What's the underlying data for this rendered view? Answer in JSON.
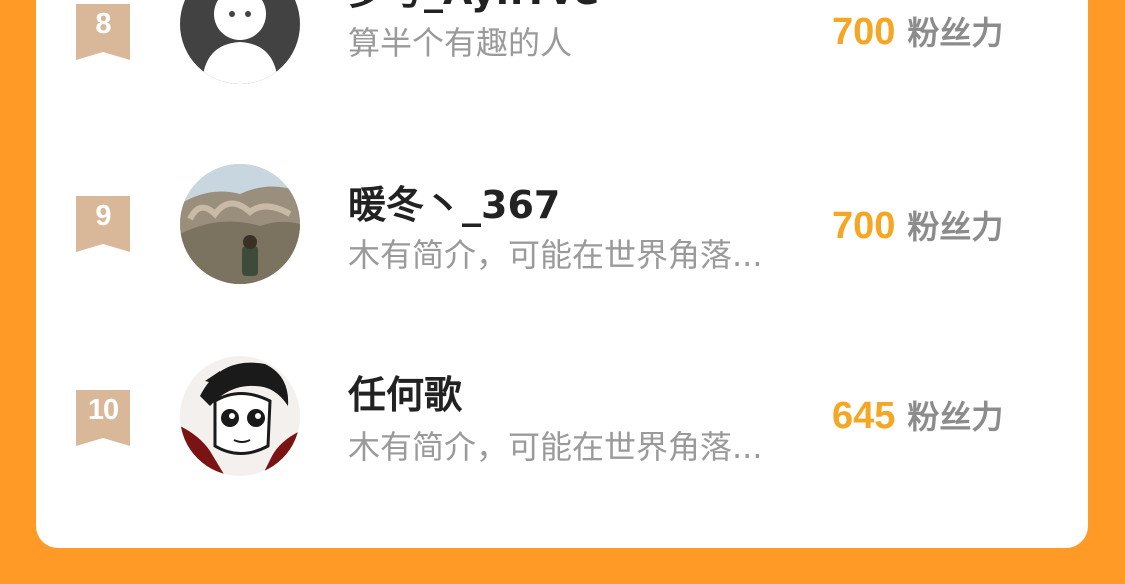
{
  "leaderboard": {
    "rows": [
      {
        "rank": "8",
        "name": "梦号_AynTve",
        "bio": "算半个有趣的人",
        "score": "700",
        "unit": "粉丝力",
        "avatar": "default-ghost-avatar"
      },
      {
        "rank": "9",
        "name": "暖冬丶_367",
        "bio": "木有简介，可能在世界角落...",
        "score": "700",
        "unit": "粉丝力",
        "avatar": "landscape-photo-avatar"
      },
      {
        "rank": "10",
        "name": "任何歌",
        "bio": "木有简介，可能在世界角落...",
        "score": "645",
        "unit": "粉丝力",
        "avatar": "anime-character-avatar"
      }
    ]
  },
  "colors": {
    "background": "#ff9a26",
    "card": "#ffffff",
    "rank_badge": "#d9b899",
    "score": "#f5a623",
    "name": "#222222",
    "bio": "#9a9a9a"
  }
}
